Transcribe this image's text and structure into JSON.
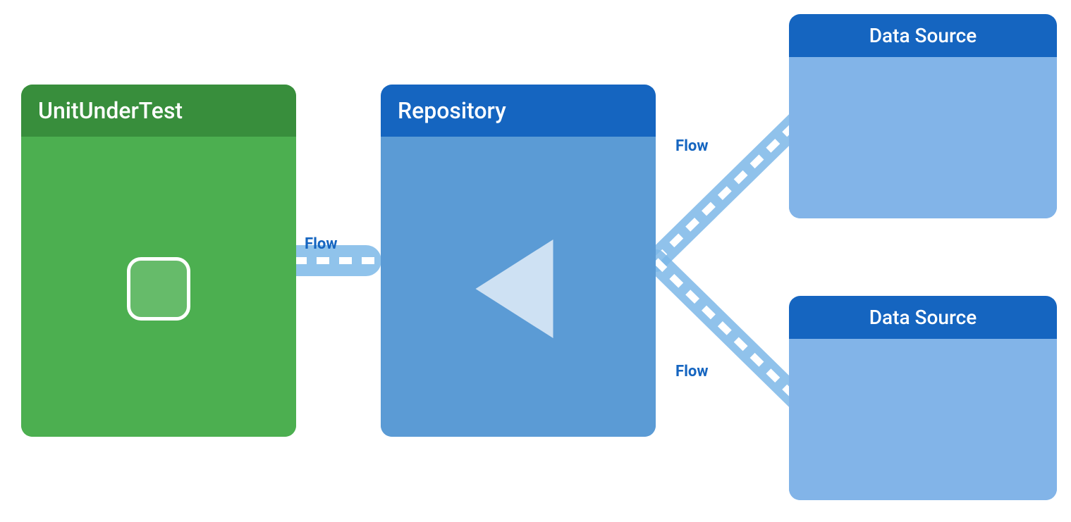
{
  "diagram": {
    "background": "#ffffff",
    "unit": {
      "label": "UnitUnderTest",
      "header_bg": "#388e3c",
      "body_bg": "#4caf50"
    },
    "repository": {
      "label": "Repository",
      "header_bg": "#1565c0",
      "body_bg": "#5b9bd5"
    },
    "datasource_top": {
      "label": "Data Source",
      "header_bg": "#1565c0",
      "body_bg": "#82b4e8"
    },
    "datasource_bottom": {
      "label": "Data Source",
      "header_bg": "#1565c0",
      "body_bg": "#82b4e8"
    },
    "flow_labels": {
      "center": "Flow",
      "top": "Flow",
      "bottom": "Flow"
    }
  }
}
